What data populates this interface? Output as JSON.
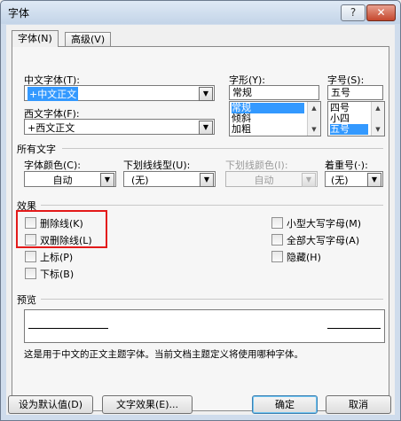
{
  "window": {
    "title": "字体",
    "help_label": "?",
    "close_label": "✕"
  },
  "tabs": [
    {
      "label": "字体(N)"
    },
    {
      "label": "高级(V)"
    }
  ],
  "font": {
    "chinese_font_label": "中文字体(T):",
    "chinese_font_value": "+中文正文",
    "western_font_label": "西文字体(F):",
    "western_font_value": "+西文正文",
    "style_label": "字形(Y):",
    "style_value": "常规",
    "style_options": [
      "常规",
      "倾斜",
      "加粗"
    ],
    "size_label": "字号(S):",
    "size_value": "五号",
    "size_options": [
      "四号",
      "小四",
      "五号"
    ]
  },
  "all_text": {
    "section_label": "所有文字",
    "font_color_label": "字体颜色(C):",
    "font_color_value": "自动",
    "underline_type_label": "下划线线型(U):",
    "underline_type_value": "(无)",
    "underline_color_label": "下划线颜色(I):",
    "underline_color_value": "自动",
    "emphasis_label": "着重号(·):",
    "emphasis_value": "(无)"
  },
  "effects": {
    "section_label": "效果",
    "strikethrough": "删除线(K)",
    "double_strikethrough": "双删除线(L)",
    "superscript": "上标(P)",
    "subscript": "下标(B)",
    "small_caps": "小型大写字母(M)",
    "all_caps": "全部大写字母(A)",
    "hidden": "隐藏(H)"
  },
  "preview": {
    "section_label": "预览",
    "description": "这是用于中文的正文主题字体。当前文档主题定义将使用哪种字体。"
  },
  "buttons": {
    "set_default": "设为默认值(D)",
    "text_effects": "文字效果(E)...",
    "ok": "确定",
    "cancel": "取消"
  },
  "colors": {
    "highlight_box": "#e31a1a",
    "selection": "#3399ff"
  }
}
